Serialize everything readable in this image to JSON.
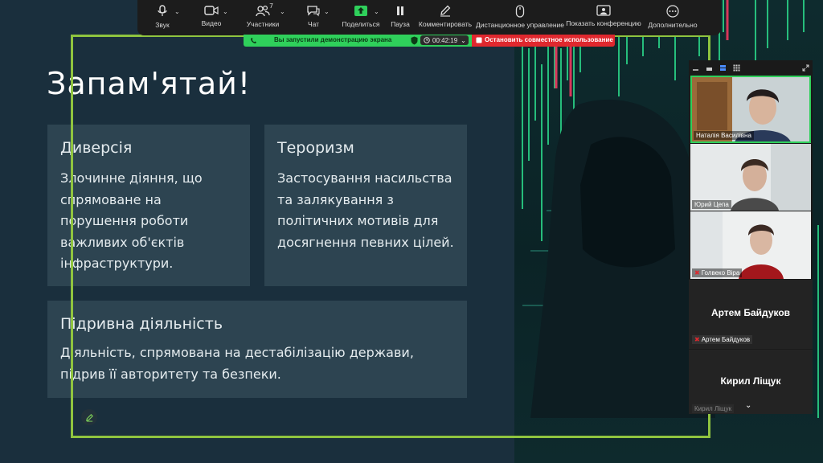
{
  "toolbar": {
    "audio_label": "Звук",
    "video_label": "Видео",
    "participants_label": "Участники",
    "participants_count": "7",
    "chat_label": "Чат",
    "share_label": "Поделиться",
    "pause_label": "Пауза",
    "annotate_label": "Комментировать",
    "remote_label": "Дистанционное управление",
    "show_conf_label": "Показать конференцию",
    "more_label": "Дополнительно"
  },
  "share_bar": {
    "status": "Вы запустили демонстрацию экрана",
    "timer": "00:42:19",
    "stop_label": "Остановить совместное использование",
    "status_color": "#2fd05b",
    "stop_color": "#e0282e"
  },
  "slide": {
    "title": "Запам'ятай!",
    "cards": [
      {
        "heading": "Диверсія",
        "body": "Злочинне діяння, що спрямоване на порушення роботи важливих об'єктів інфраструктури."
      },
      {
        "heading": "Тероризм",
        "body": "Застосування насильства та залякування з політичних мотивів для досягнення певних цілей."
      },
      {
        "heading": "Підривна діяльність",
        "body": "Діяльність, спрямована на дестабілізацію держави, підрив її авторитету та безпеки."
      }
    ],
    "accent_color": "#8fc43f"
  },
  "participants": {
    "tiles": [
      {
        "name": "Наталія Василівна"
      },
      {
        "name": "Юрий Цепа"
      },
      {
        "name": "Голвеко Віра"
      }
    ],
    "cards": [
      {
        "display": "Артем Байдуков",
        "label": "Артем Байдуков"
      },
      {
        "display": "Кирил Ліщук",
        "label": "Кирил Ліщук"
      }
    ]
  }
}
